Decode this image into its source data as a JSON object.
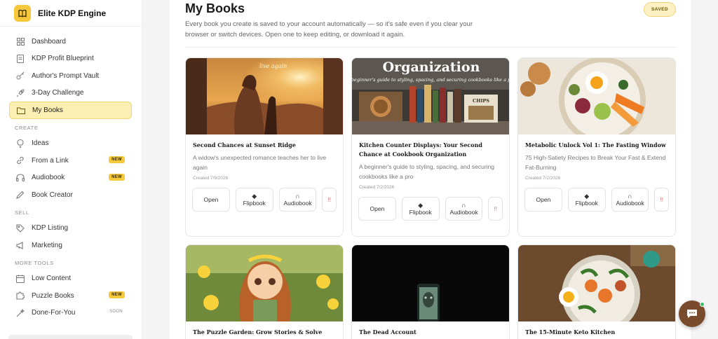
{
  "brand": {
    "name": "Elite KDP Engine"
  },
  "sidebar": {
    "main_items": [
      {
        "label": "Dashboard",
        "icon": "grid-icon"
      },
      {
        "label": "KDP Profit Blueprint",
        "icon": "document-icon"
      },
      {
        "label": "Author's Prompt Vault",
        "icon": "key-icon"
      },
      {
        "label": "3-Day Challenge",
        "icon": "rocket-icon"
      },
      {
        "label": "My Books",
        "icon": "folder-icon",
        "active": true
      }
    ],
    "create_label": "CREATE",
    "create_items": [
      {
        "label": "Ideas",
        "icon": "lightbulb-icon"
      },
      {
        "label": "From a Link",
        "icon": "link-icon",
        "badge": "NEW"
      },
      {
        "label": "Audiobook",
        "icon": "headphones-icon",
        "badge": "NEW"
      },
      {
        "label": "Book Creator",
        "icon": "pen-icon"
      }
    ],
    "sell_label": "SELL",
    "sell_items": [
      {
        "label": "KDP Listing",
        "icon": "tag-icon"
      },
      {
        "label": "Marketing",
        "icon": "megaphone-icon"
      }
    ],
    "more_label": "MORE TOOLS",
    "more_items": [
      {
        "label": "Low Content",
        "icon": "calendar-icon"
      },
      {
        "label": "Puzzle Books",
        "icon": "puzzle-icon",
        "badge": "NEW"
      },
      {
        "label": "Done-For-You",
        "icon": "wand-icon",
        "badge": "SOON"
      }
    ]
  },
  "main": {
    "title": "My Books",
    "description": "Every book you create is saved to your account automatically — so it's safe even if you clear your browser or switch devices. Open one to keep editing, or download it again.",
    "saved_label": "SAVED"
  },
  "buttons": {
    "open": "Open",
    "flipbook": "Flipbook",
    "audiobook": "Audiobook",
    "delete_glyph": "!!"
  },
  "books": [
    {
      "title": "Second Chances at Sunset Ridge",
      "subtitle": "A widow's unexpected romance teaches her to live again",
      "created": "Created 7/9/2026",
      "cover_text": "live again"
    },
    {
      "title": "Kitchen Counter Displays: Your Second Chance at Cookbook Organization",
      "subtitle": "A beginner's guide to styling, spacing, and securing cookbooks like a pro",
      "created": "Created 7/2/2026",
      "cover_title": "Organization",
      "cover_subtitle": "a beginner's guide to styling, spacing, and securing cookbooks like a pro",
      "cover_book_label": "CHIPS"
    },
    {
      "title": "Metabolic Unlock Vol 1: The Fasting Window",
      "subtitle": "75 High-Satiety Recipes to Break Your Fast & Extend Fat-Burning",
      "created": "Created 7/2/2026"
    },
    {
      "title": "The Puzzle Garden: Grow Stories & Solve Secrets"
    },
    {
      "title": "The Dead Account"
    },
    {
      "title": "The 15-Minute Keto Kitchen"
    }
  ],
  "colors": {
    "accent": "#f6c83b",
    "active_bg": "#fcefb4",
    "chat": "#7a4a2c"
  }
}
